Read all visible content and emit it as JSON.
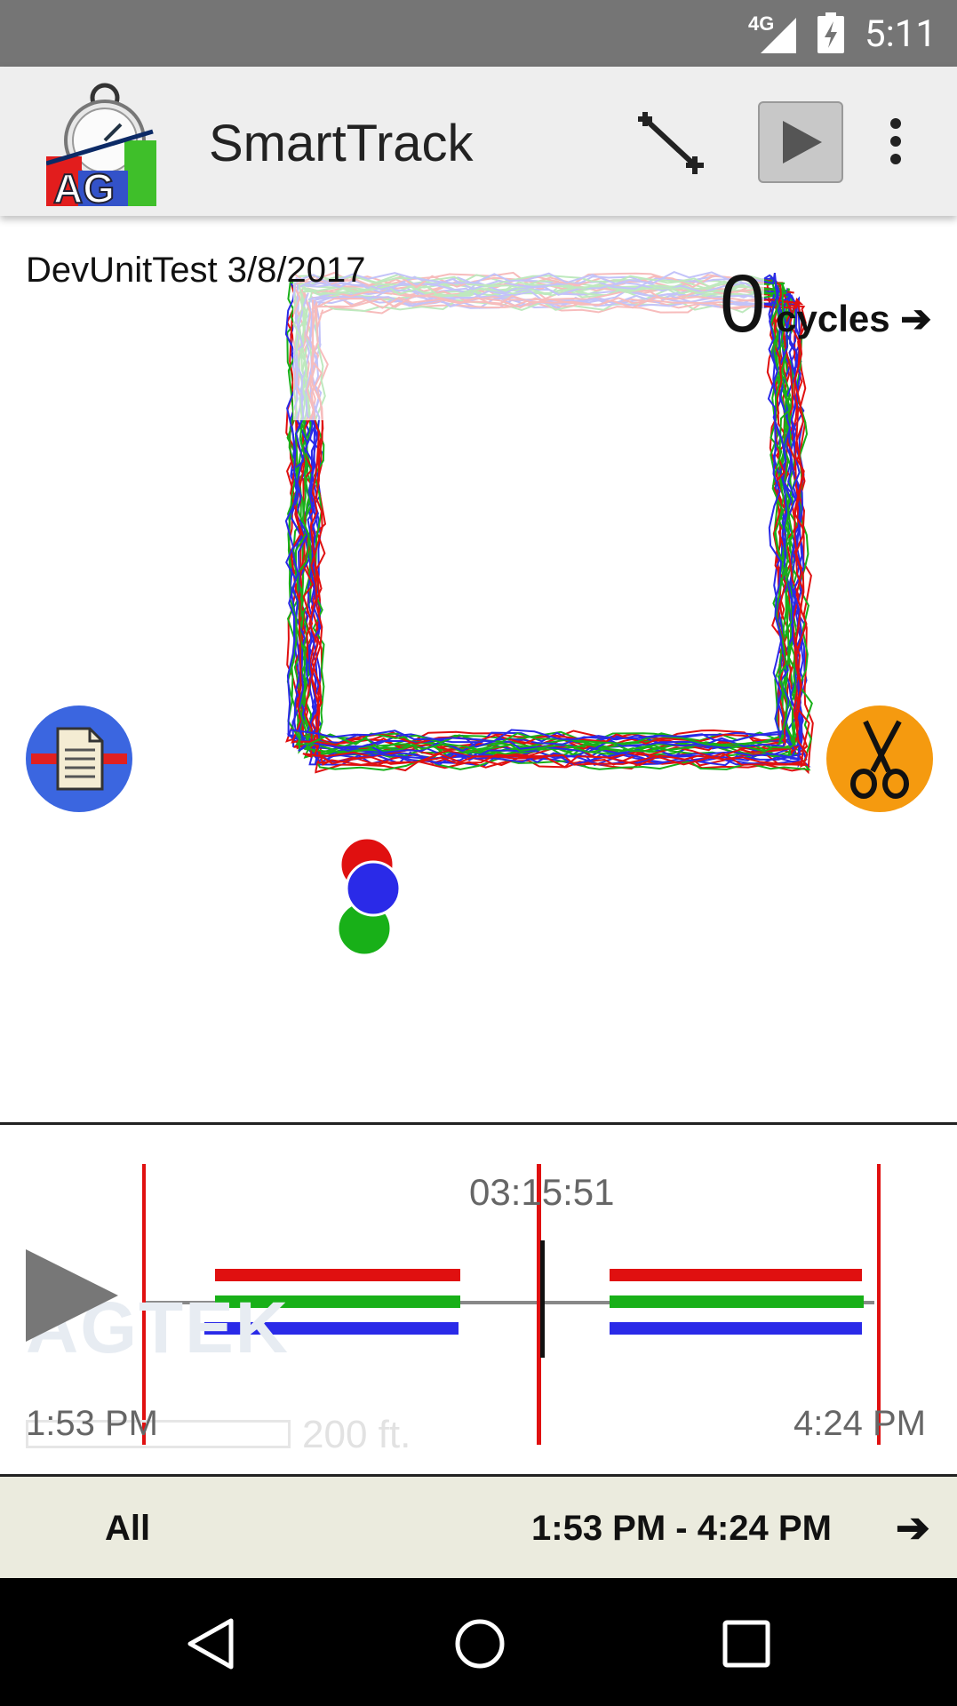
{
  "status_bar": {
    "network": "4G",
    "time": "5:11",
    "icons": [
      "signal-icon",
      "battery-charging-icon"
    ]
  },
  "app_bar": {
    "title": "SmartTrack",
    "logo_text": "AG",
    "actions": [
      "measure-icon",
      "play-icon",
      "overflow-menu-icon"
    ]
  },
  "map": {
    "job_label": "DevUnitTest 3/8/2017",
    "cycles_count": "0",
    "cycles_label": "cycles ➔",
    "track_colors": [
      "#e01010",
      "#18b018",
      "#2a2ae8"
    ],
    "buttons": [
      "report-icon",
      "scissors-icon"
    ]
  },
  "timeline": {
    "current_time": "03:15:51",
    "start_time": "1:53 PM",
    "end_time": "4:24 PM",
    "watermark": "AGTEK",
    "scale_label": "200 ft."
  },
  "filter_bar": {
    "scope": "All",
    "range": "1:53 PM - 4:24 PM",
    "arrow": "➔"
  },
  "nav_bar": [
    "back-icon",
    "home-icon",
    "recents-icon"
  ]
}
